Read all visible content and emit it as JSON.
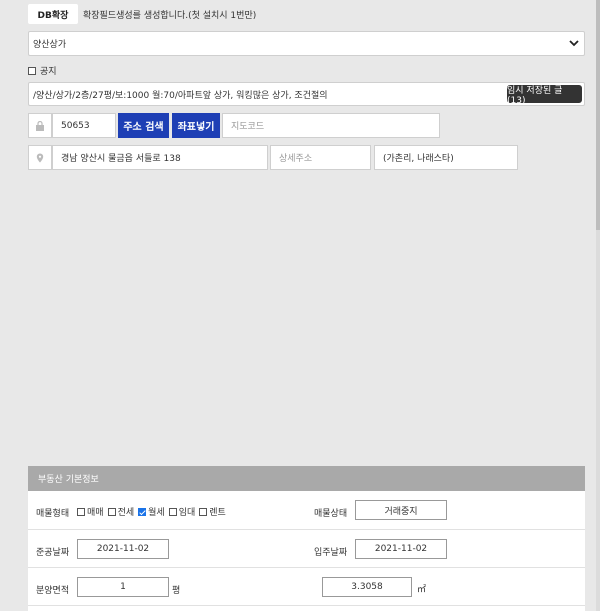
{
  "header": {
    "db_tab_label": "DB확장",
    "description": "확장필드생성를 생성합니다.(첫 설치시 1번만)"
  },
  "category": {
    "selected": "양산상가"
  },
  "notice": {
    "label": "공지",
    "checked": false
  },
  "title_input": {
    "value": "/양산/상가/2층/27평/보:1000 월:70/아파트앞 상가, 워킹많은 상가, 조건절의"
  },
  "temp_saved_button": {
    "label": "임시 저장된 글 (13)"
  },
  "address": {
    "zipcode": "50653",
    "search_button": "주소 검색",
    "coord_button": "좌표넣기",
    "geocode_placeholder": "지도코드",
    "road_address": "경남 양산시 물금읍 서들로 138",
    "detail_placeholder": "상세주소",
    "extra": "(가촌리, 나래스타)"
  },
  "basic_info": {
    "header": "부동산 기본정보",
    "type_label": "매물형태",
    "type_options": [
      {
        "label": "매매",
        "checked": false
      },
      {
        "label": "전세",
        "checked": false
      },
      {
        "label": "월세",
        "checked": true
      },
      {
        "label": "임대",
        "checked": false
      },
      {
        "label": "렌트",
        "checked": false
      }
    ],
    "status_label": "매물상태",
    "status_value": "거래중지",
    "completion_label": "준공날짜",
    "completion_value": "2021-11-02",
    "movein_label": "입주날짜",
    "movein_value": "2021-11-02",
    "area_label": "분양면적",
    "area_pyeong": "1",
    "pyeong_unit": "평",
    "area_m2": "3.3058",
    "m2_unit": "㎡"
  }
}
